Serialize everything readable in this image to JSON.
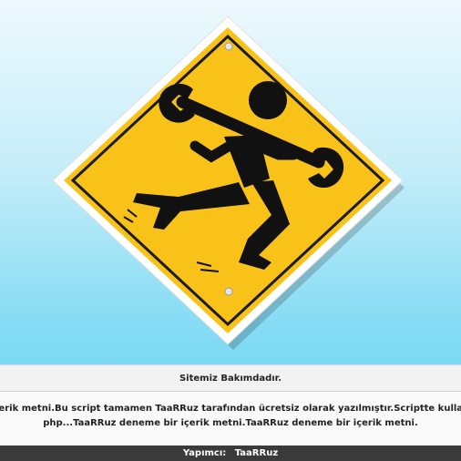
{
  "sign": {
    "icon": "maintenance-worker-with-wrench-icon",
    "colors": {
      "sign_yellow": "#f8c219",
      "sign_border": "#1b1b1b",
      "sign_outer": "#ffffff",
      "bolt": "#d9d9d9"
    }
  },
  "notice": {
    "title": "Sitemiz Bakımdadır.",
    "line1": "bir içerik metni.Bu script tamamen TaaRRuz tarafından ücretsiz olarak yazılmıştır.Scriptte kullanılan",
    "line2": "php...TaaRRuz deneme bir içerik metni.TaaRRuz deneme bir içerik metni."
  },
  "footer": {
    "label": "Yapımcı:",
    "author": "TaaRRuz"
  },
  "colors": {
    "background_top": "#eef9fd",
    "background_bottom": "#63d1f0",
    "footer_bg": "#3a3a3a"
  }
}
